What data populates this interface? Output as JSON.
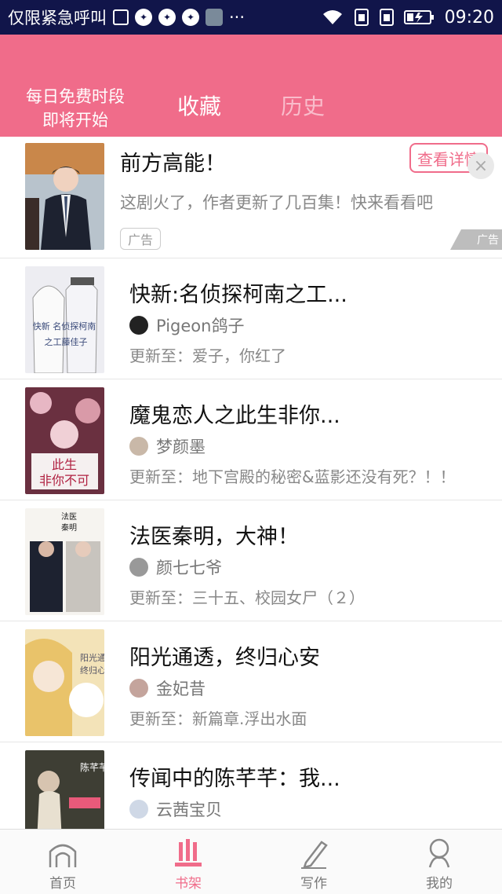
{
  "status_bar": {
    "carrier": "仅限紧急呼叫",
    "time": "09:20",
    "more": "···"
  },
  "header": {
    "free_line1": "每日免费时段",
    "free_line2": "即将开始",
    "tab_collect": "收藏",
    "tab_history": "历史",
    "accent": "#f06c8a"
  },
  "ad": {
    "title": "前方高能！",
    "desc": "这剧火了，作者更新了几百集！快来看看吧",
    "badge": "广告",
    "button": "查看详情",
    "close": "×",
    "corner": "广告"
  },
  "items": [
    {
      "title": "快新:名侦探柯南之工...",
      "author": "Pigeon鸽子",
      "update": "更新至：爱子，你红了",
      "cover_color": "#e9e9ef",
      "avatar_color": "#222"
    },
    {
      "title": "魔鬼恋人之此生非你...",
      "author": "梦颜墨",
      "update": "更新至：地下宫殿的秘密&蓝影还没有死？！！",
      "cover_color": "#7a3b4a",
      "avatar_color": "#c9b8a8"
    },
    {
      "title": "法医秦明，大神！",
      "author": "颜七七爷",
      "update": "更新至：三十五、校园女尸（２）",
      "cover_color": "#f2efea",
      "avatar_color": "#999"
    },
    {
      "title": "阳光通透，终归心安",
      "author": "金妃昔",
      "update": "更新至：新篇章.浮出水面",
      "cover_color": "#f0d79a",
      "avatar_color": "#c4a49c"
    },
    {
      "title": "传闻中的陈芊芊：我...",
      "author": "云茜宝贝",
      "update": "",
      "cover_color": "#4a4a3c",
      "avatar_color": "#cfd8e6"
    }
  ],
  "nav": {
    "home": "首页",
    "shelf": "书架",
    "write": "写作",
    "mine": "我的"
  }
}
